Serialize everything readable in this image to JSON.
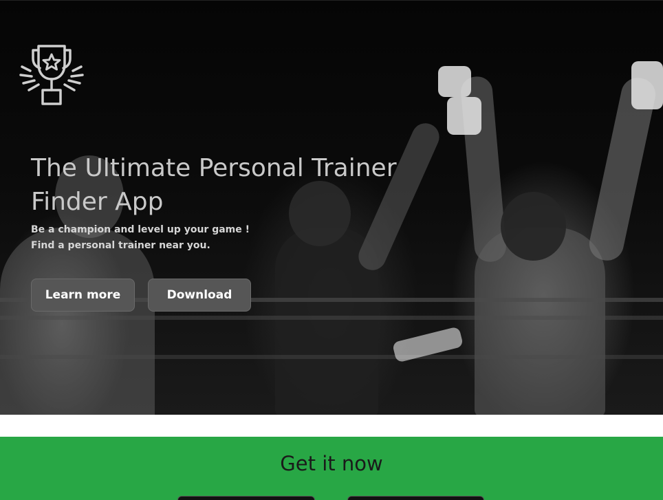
{
  "hero": {
    "logo_icon": "trophy-icon",
    "title": "The Ultimate Personal Trainer Finder App",
    "subtitle_line1": "Be a champion and level up your game !",
    "subtitle_line2": "Find a personal trainer near you.",
    "learn_more_label": "Learn more",
    "download_label": "Download"
  },
  "cta": {
    "title": "Get it now",
    "badges": [
      "app-store-badge",
      "google-play-badge"
    ]
  },
  "colors": {
    "cta_background": "#28a745",
    "button_background": "#565656",
    "hero_text": "#c9c9c9"
  }
}
